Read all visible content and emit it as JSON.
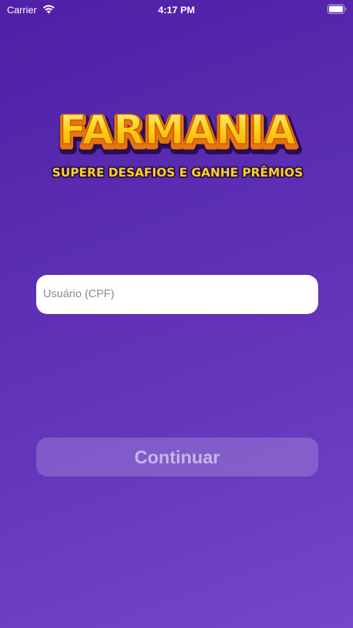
{
  "status_bar": {
    "carrier": "Carrier",
    "time": "4:17 PM",
    "icons": [
      "wifi-icon",
      "battery-icon"
    ]
  },
  "logo": {
    "title": "FARMANIA",
    "tagline": "SUPERE DESAFIOS E GANHE PRÊMIOS",
    "colors": {
      "title_fill": "#ffcc1a",
      "title_outline": "#3a1466",
      "tagline_fill": "#ffd21f"
    }
  },
  "login": {
    "cpf_placeholder": "Usuário (CPF)",
    "cpf_value": "",
    "continue_label": "Continuar"
  },
  "colors": {
    "background_start": "#4f1fa6",
    "background_end": "#7446c9",
    "input_background": "#ffffff"
  }
}
